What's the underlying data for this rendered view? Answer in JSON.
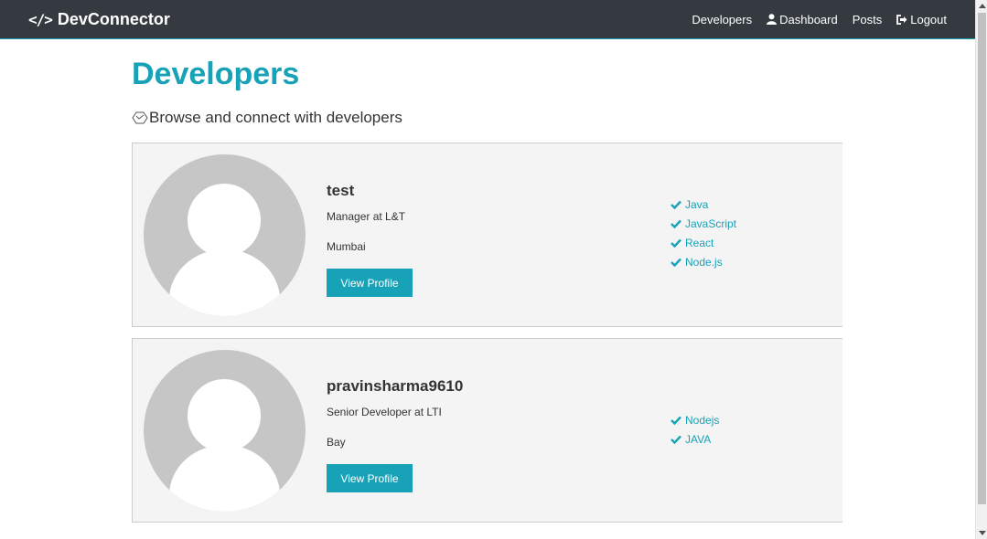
{
  "navbar": {
    "brand": "DevConnector",
    "links": {
      "developers": "Developers",
      "dashboard": "Dashboard",
      "posts": "Posts",
      "logout": "Logout"
    }
  },
  "page": {
    "title": "Developers",
    "lead": "Browse and connect with developers"
  },
  "profiles": [
    {
      "name": "test",
      "status": "Manager at L&T",
      "location": "Mumbai",
      "button": "View Profile",
      "skills": [
        "Java",
        "JavaScript",
        "React",
        "Node.js"
      ]
    },
    {
      "name": "pravinsharma9610",
      "status": "Senior Developer at LTI",
      "location": "Bay",
      "button": "View Profile",
      "skills": [
        "Nodejs",
        "JAVA"
      ]
    }
  ],
  "colors": {
    "primary": "#17a2b8",
    "navbar": "#343a40",
    "card": "#f4f4f4"
  },
  "icons": {
    "brand": "code-icon",
    "dashboard": "user-icon",
    "logout": "sign-out-icon",
    "lead": "connect-icon",
    "skill": "check-icon"
  }
}
